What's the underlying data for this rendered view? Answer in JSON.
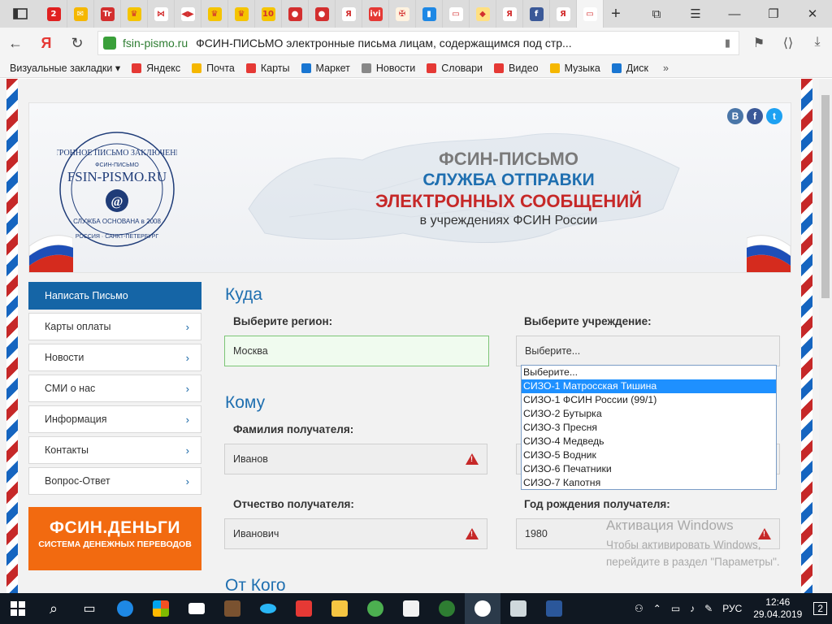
{
  "browser": {
    "tab_favicons": [
      {
        "name": "tab-opera-icon",
        "color": "#e02020",
        "glyph": "2"
      },
      {
        "name": "tab-mail-icon",
        "color": "#f5b700",
        "glyph": "✉"
      },
      {
        "name": "tab-tt-icon",
        "color": "#d32f2f",
        "glyph": "Tr"
      },
      {
        "name": "tab-crown-icon",
        "color": "#f5c400",
        "glyph": "♛"
      },
      {
        "name": "tab-bow-icon",
        "color": "#ffffff",
        "glyph": "⋈"
      },
      {
        "name": "tab-media-icon",
        "color": "#ffffff",
        "glyph": "◀▶"
      },
      {
        "name": "tab-crown-icon",
        "color": "#f5c400",
        "glyph": "♛"
      },
      {
        "name": "tab-crown-icon",
        "color": "#f5c400",
        "glyph": "♛"
      },
      {
        "name": "tab-ten-icon",
        "color": "#f5c400",
        "glyph": "10"
      },
      {
        "name": "tab-record-icon",
        "color": "#d32f2f",
        "glyph": "●"
      },
      {
        "name": "tab-record-icon",
        "color": "#d32f2f",
        "glyph": "●"
      },
      {
        "name": "tab-yandex-icon",
        "color": "#ffffff",
        "glyph": "Я"
      },
      {
        "name": "tab-ivi-icon",
        "color": "#e53935",
        "glyph": "ivi"
      },
      {
        "name": "tab-emblem-icon",
        "color": "#fff3e0",
        "glyph": "✠"
      },
      {
        "name": "tab-chart-icon",
        "color": "#1e88e5",
        "glyph": "▮"
      },
      {
        "name": "tab-doc-icon",
        "color": "#ffffff",
        "glyph": "▭"
      },
      {
        "name": "tab-badge-icon",
        "color": "#ffe082",
        "glyph": "◆"
      },
      {
        "name": "tab-yandex-icon",
        "color": "#ffffff",
        "glyph": "Я"
      },
      {
        "name": "tab-facebook-icon",
        "color": "#3b5998",
        "glyph": "f"
      },
      {
        "name": "tab-yandex-icon",
        "color": "#ffffff",
        "glyph": "Я"
      },
      {
        "name": "tab-doc-active-icon",
        "color": "#ffffff",
        "glyph": "▭"
      }
    ],
    "new_tab": "+",
    "url_domain": "fsin-pismo.ru",
    "page_title": "ФСИН-ПИСЬМО электронные письма лицам, содержащимся под стр...",
    "bookmarks": [
      {
        "label": "Визуальные закладки ▾",
        "color": "#f4f4f4"
      },
      {
        "label": "Яндекс",
        "color": "#e53935"
      },
      {
        "label": "Почта",
        "color": "#f5b700"
      },
      {
        "label": "Карты",
        "color": "#e53935"
      },
      {
        "label": "Маркет",
        "color": "#1976d2"
      },
      {
        "label": "Новости",
        "color": "#888888"
      },
      {
        "label": "Словари",
        "color": "#e53935"
      },
      {
        "label": "Видео",
        "color": "#e53935"
      },
      {
        "label": "Музыка",
        "color": "#f5b700"
      },
      {
        "label": "Диск",
        "color": "#1976d2"
      }
    ],
    "bookmarks_more": "»"
  },
  "banner": {
    "logo_top": "ЭЛЕКТРОННОЕ ПИСЬМО ЗАКЛЮЧЕННОМУ",
    "logo_sub": "ФСИН-ПИСЬМО",
    "logo_name": "FSIN-PISMO.RU",
    "logo_bottom": "СЛУЖБА ОСНОВАНА в 2008",
    "logo_ring": "РОССИЯ · САНКТ-ПЕТЕРБУРГ",
    "line1": "ФСИН-ПИСЬМО",
    "line2": "СЛУЖБА ОТПРАВКИ",
    "line3": "ЭЛЕКТРОННЫХ СООБЩЕНИЙ",
    "line4": "в учреждениях ФСИН России",
    "social": [
      {
        "label": "B",
        "color": "#4a76a8",
        "name": "vk-icon"
      },
      {
        "label": "f",
        "color": "#3b5998",
        "name": "facebook-icon"
      },
      {
        "label": "t",
        "color": "#1da1f2",
        "name": "twitter-icon"
      }
    ]
  },
  "sidebar": {
    "items": [
      {
        "label": "Написать Письмо",
        "active": true
      },
      {
        "label": "Карты оплаты"
      },
      {
        "label": "Новости"
      },
      {
        "label": "СМИ о нас"
      },
      {
        "label": "Информация"
      },
      {
        "label": "Контакты"
      },
      {
        "label": "Вопрос-Ответ"
      }
    ],
    "money_title": "ФСИН.ДЕНЬГИ",
    "money_sub": "СИСТЕМА ДЕНЕЖНЫХ ПЕРЕВОДОВ"
  },
  "form": {
    "section_where": "Куда",
    "region_label": "Выберите регион:",
    "region_value": "Москва",
    "institution_label": "Выберите учреждение:",
    "institution_value": "Выберите...",
    "dropdown_options": [
      "Выберите...",
      "СИЗО-1 Матросская Тишина",
      "СИЗО-1 ФСИН России (99/1)",
      "СИЗО-2 Бутырка",
      "СИЗО-3 Пресня",
      "СИЗО-4 Медведь",
      "СИЗО-5 Водник",
      "СИЗО-6 Печатники",
      "СИЗО-7 Капотня"
    ],
    "dropdown_selected_index": 1,
    "section_to": "Кому",
    "surname_label": "Фамилия получателя:",
    "surname_value": "Иванов",
    "patronymic_label": "Отчество получателя:",
    "patronymic_value": "Иванович",
    "birthyear_label": "Год рождения получателя:",
    "birthyear_value": "1980",
    "section_from": "От Кого"
  },
  "watermark": {
    "line1": "Активация Windows",
    "line2": "Чтобы активировать Windows,",
    "line3": "перейдите в раздел \"Параметры\"."
  },
  "taskbar": {
    "lang": "РУС",
    "time": "12:46",
    "date": "29.04.2019",
    "notifications": "2"
  }
}
